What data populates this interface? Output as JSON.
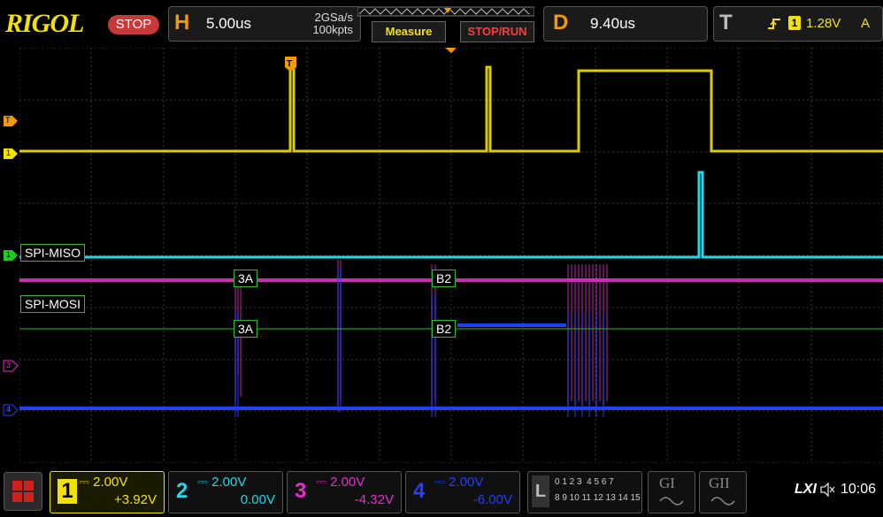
{
  "brand": "RIGOL",
  "run_state": "STOP",
  "horizontal": {
    "letter": "H",
    "timebase": "5.00us",
    "sample_rate": "2GSa/s",
    "memory_depth": "100kpts"
  },
  "buttons": {
    "measure": "Measure",
    "stop_run": "STOP/RUN"
  },
  "delay": {
    "letter": "D",
    "value": "9.40us"
  },
  "trigger": {
    "letter": "T",
    "source": "1",
    "level": "1.28V",
    "mode": "A"
  },
  "decoders": {
    "miso_label": "SPI-MISO",
    "mosi_label": "SPI-MOSI",
    "miso_values": [
      "3A",
      "B2"
    ],
    "mosi_values": [
      "3A",
      "B2"
    ]
  },
  "left_markers": {
    "trigger": "T",
    "ch1": "1",
    "ch2": "1",
    "ch3": "3",
    "ch4": "4"
  },
  "channels": [
    {
      "num": "1",
      "scale": "2.00V",
      "offset": "+3.92V",
      "color": "#f3e200"
    },
    {
      "num": "2",
      "scale": "2.00V",
      "offset": "0.00V",
      "color": "#22d8e8"
    },
    {
      "num": "3",
      "scale": "2.00V",
      "offset": "-4.32V",
      "color": "#e030c8"
    },
    {
      "num": "4",
      "scale": "2.00V",
      "offset": "-6.00V",
      "color": "#2040ff"
    }
  ],
  "logic": {
    "letter": "L",
    "row1": "0 1 2 3  4 5 6 7",
    "row2": "8 9 10 11 12 13 14 15"
  },
  "gens": [
    "GI",
    "GII"
  ],
  "status": {
    "lxi": "LXI",
    "time": "10:06"
  },
  "colors": {
    "ch1": "#f3e200",
    "ch2": "#22d8e8",
    "ch3": "#e030c8",
    "ch4": "#2040ff",
    "grid": "#3a3a3a",
    "decode_border": "#2bbf2b",
    "accent": "#f39a00"
  }
}
